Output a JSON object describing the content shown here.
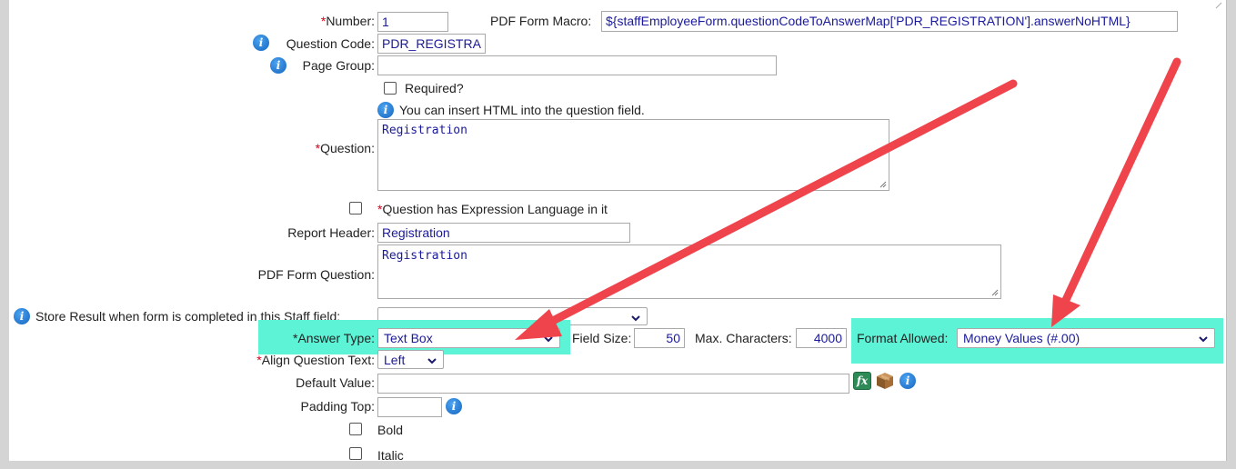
{
  "form": {
    "number": {
      "label": "Number:",
      "value": "1"
    },
    "pdf_macro": {
      "label": "PDF Form Macro:",
      "value": "${staffEmployeeForm.questionCodeToAnswerMap['PDR_REGISTRATION'].answerNoHTML}"
    },
    "question_code": {
      "label": "Question Code:",
      "value": "PDR_REGISTRA"
    },
    "page_group": {
      "label": "Page Group:",
      "value": ""
    },
    "required": {
      "label": "Required?",
      "checked": false
    },
    "html_hint": "You can insert HTML into the question field.",
    "question": {
      "label": "Question:",
      "value": "Registration"
    },
    "expression_language": {
      "label": "Question has Expression Language in it",
      "checked": false
    },
    "report_header": {
      "label": "Report Header:",
      "value": "Registration"
    },
    "pdf_form_question": {
      "label": "PDF Form Question:",
      "value": "Registration"
    },
    "store_result": {
      "label": "Store Result when form is completed in this Staff field:",
      "value": ""
    },
    "answer_type": {
      "label": "Answer Type:",
      "value": "Text Box"
    },
    "field_size": {
      "label": "Field Size:",
      "value": "50"
    },
    "max_characters": {
      "label": "Max. Characters:",
      "value": "4000"
    },
    "format_allowed": {
      "label": "Format Allowed:",
      "value": "Money Values (#.00)"
    },
    "align_question_text": {
      "label": "Align Question Text:",
      "value": "Left"
    },
    "default_value": {
      "label": "Default Value:",
      "value": ""
    },
    "padding_top": {
      "label": "Padding Top:",
      "value": ""
    },
    "bold": {
      "label": "Bold",
      "checked": false
    },
    "italic": {
      "label": "Italic",
      "checked": false
    }
  },
  "required_marker": "*",
  "icons": {
    "info": "info-icon",
    "fx": "fx-icon",
    "box": "package-icon",
    "arrow": "red-arrow-annotation"
  },
  "colors": {
    "highlight": "#5cf3d6",
    "arrow": "#f0444d",
    "input_text": "#1a1a9a",
    "required": "#d9001b"
  }
}
